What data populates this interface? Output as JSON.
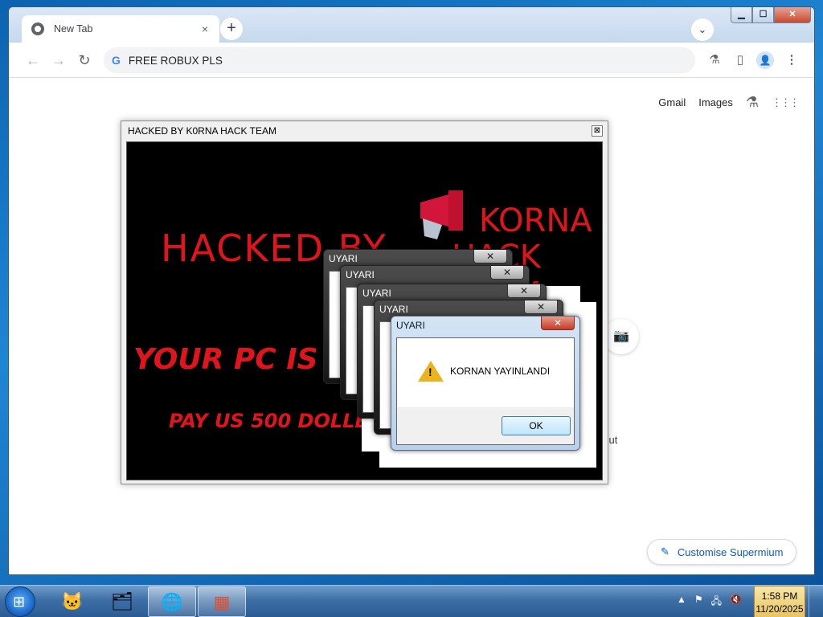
{
  "browser": {
    "tab_title": "New Tab",
    "tab_close": "×",
    "new_tab": "+",
    "tab_search": "⌄",
    "window_controls": {
      "minimize": "▁",
      "maximize": "☐",
      "close": "✕"
    },
    "nav": {
      "back": "←",
      "forward": "→",
      "reload": "↻"
    },
    "omnibox_icon": "G",
    "url": "FREE ROBUX PLS",
    "toolbar_icons": {
      "labs": "⚗",
      "side_panel": "▯",
      "profile": "👤",
      "menu": "⋮"
    }
  },
  "ntp": {
    "gmail": "Gmail",
    "images": "Images",
    "labs_icon": "⚗",
    "apps_icon": "⋮⋮⋮",
    "camera_icon": "📷",
    "shortcut_fragment": "cut",
    "customise": "Customise Supermium",
    "customise_icon": "✎"
  },
  "hack_window": {
    "title": "HACKED BY K0RNA HACK TEAM",
    "close": "⊠",
    "line1": "HACKED BY",
    "line2": "YOUR PC IS H",
    "line3": "PAY US 500 DOLLER",
    "logo_line1": "KORNA",
    "logo_line2": "HACK TEAM"
  },
  "dialogs": {
    "title": "UYARI",
    "close": "✕",
    "message": "KORNAN YAYINLANDI",
    "ok": "OK",
    "warn_glyph": "!"
  },
  "taskbar": {
    "start_glyph": "⊞",
    "apps": [
      "🐱",
      "🗂",
      "🌐",
      "▦"
    ],
    "tray": {
      "up": "▲",
      "flag": "⚑",
      "network": "🖧",
      "volume": "🔇"
    },
    "time": "1:58 PM",
    "date": "11/20/2025"
  },
  "colors": {
    "hack_red": "#e0141c",
    "accent": "#0b57d0"
  }
}
